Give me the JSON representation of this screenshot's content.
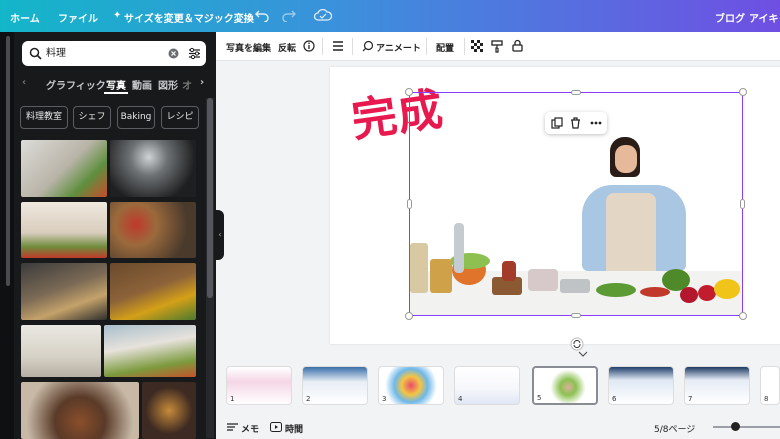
{
  "topbar": {
    "home": "ホーム",
    "file": "ファイル",
    "resize": "サイズを変更＆マジック変換",
    "blog": "ブログ",
    "eyecatch": "アイキャ"
  },
  "panel": {
    "search_value": "料理",
    "categories": [
      "グラフィック",
      "写真",
      "動画",
      "図形",
      "オ"
    ],
    "active_category": "写真",
    "chips": [
      "料理教室",
      "シェフ",
      "Baking",
      "レシピ"
    ]
  },
  "toolbar": {
    "edit_photo": "写真を編集",
    "flip": "反転",
    "animate": "アニメート",
    "position": "配置"
  },
  "canvas": {
    "overlay_text": "完成"
  },
  "pages": [
    "1",
    "2",
    "3",
    "4",
    "5",
    "6",
    "7",
    "8"
  ],
  "current_page": "5",
  "bottombar": {
    "memo": "メモ",
    "time": "時間",
    "page_indicator": "5/8ページ"
  },
  "colors": {
    "accent": "#8b3dff",
    "overlay_text": "#e8194e",
    "panel_bg": "#18191b"
  }
}
